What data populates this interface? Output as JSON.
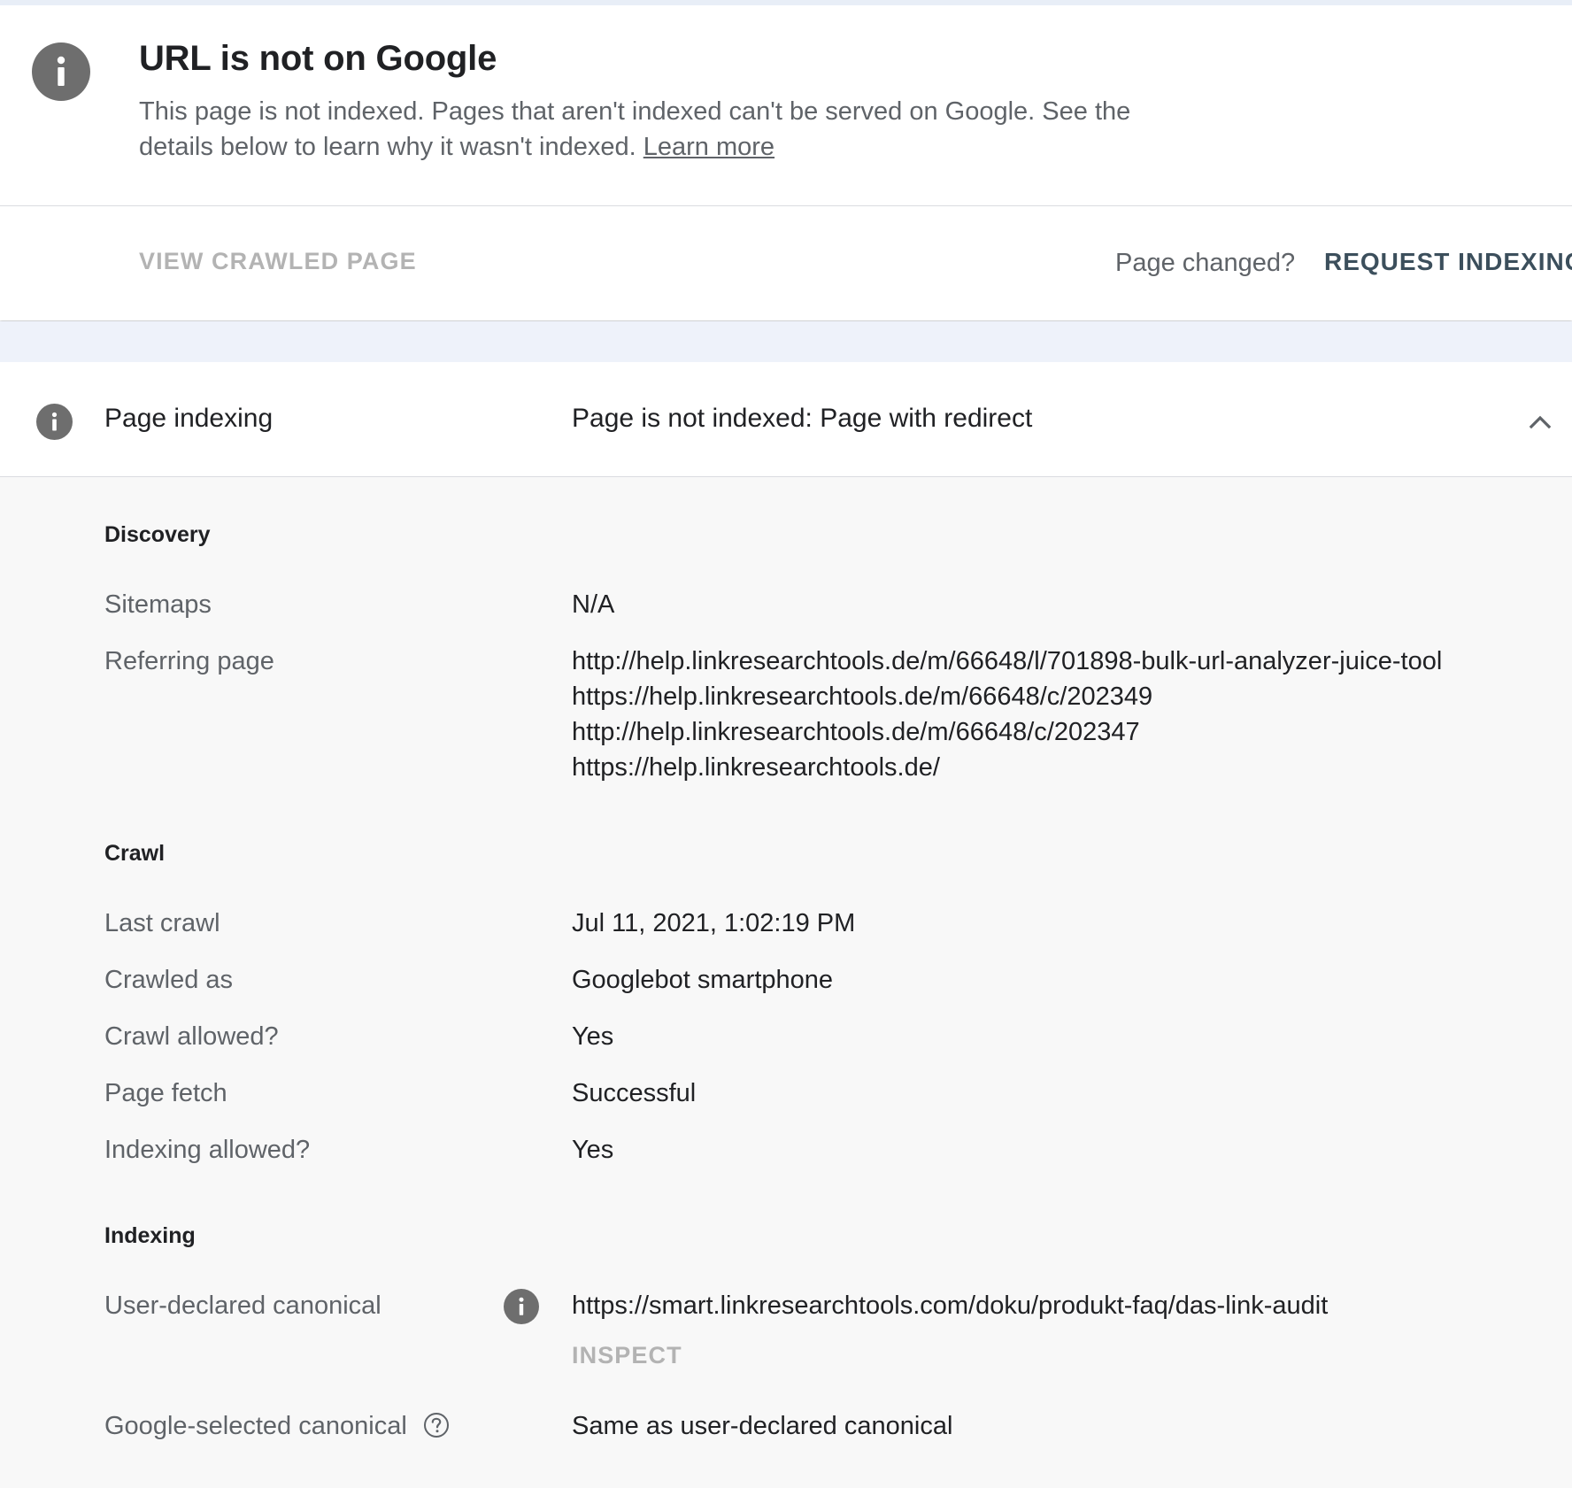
{
  "status": {
    "icon": "info-icon",
    "title": "URL is not on Google",
    "description": "This page is not indexed. Pages that aren't indexed can't be served on Google. See the details below to learn why it wasn't indexed.",
    "learn_more": "Learn more"
  },
  "actions": {
    "view_crawled_page": "VIEW CRAWLED PAGE",
    "page_changed": "Page changed?",
    "request_indexing": "REQUEST INDEXING"
  },
  "page_indexing": {
    "title": "Page indexing",
    "status": "Page is not indexed: Page with redirect",
    "expanded": true
  },
  "discovery": {
    "heading": "Discovery",
    "sitemaps_label": "Sitemaps",
    "sitemaps_value": "N/A",
    "referring_page_label": "Referring page",
    "referring_pages": [
      "http://help.linkresearchtools.de/m/66648/l/701898-bulk-url-analyzer-juice-tool",
      "https://help.linkresearchtools.de/m/66648/c/202349",
      "http://help.linkresearchtools.de/m/66648/c/202347",
      "https://help.linkresearchtools.de/"
    ]
  },
  "crawl": {
    "heading": "Crawl",
    "last_crawl_label": "Last crawl",
    "last_crawl_value": "Jul 11, 2021, 1:02:19 PM",
    "crawled_as_label": "Crawled as",
    "crawled_as_value": "Googlebot smartphone",
    "crawl_allowed_label": "Crawl allowed?",
    "crawl_allowed_value": "Yes",
    "page_fetch_label": "Page fetch",
    "page_fetch_value": "Successful",
    "indexing_allowed_label": "Indexing allowed?",
    "indexing_allowed_value": "Yes"
  },
  "indexing": {
    "heading": "Indexing",
    "user_canonical_label": "User-declared canonical",
    "user_canonical_value": "https://smart.linkresearchtools.com/doku/produkt-faq/das-link-audit",
    "inspect_label": "INSPECT",
    "google_canonical_label": "Google-selected canonical",
    "google_canonical_value": "Same as user-declared canonical"
  },
  "colors": {
    "icon_gray": "#6e6e6e",
    "text_primary": "#202124",
    "text_secondary": "#5f6368",
    "disabled": "#b3b3b3",
    "action": "#3c4f5c",
    "band": "#eef2fa"
  }
}
